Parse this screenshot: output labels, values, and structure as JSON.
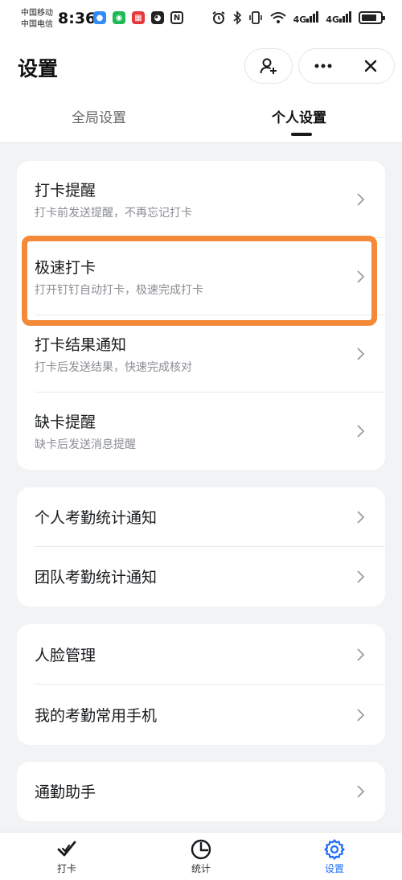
{
  "status_bar": {
    "carrier_1": "中国移动",
    "carrier_2": "中国电信",
    "time": "8:36",
    "signal_1": "4G",
    "signal_2": "4G"
  },
  "header": {
    "title": "设置",
    "add_contact_icon": "person-add-icon",
    "more_icon": "more-icon",
    "close_icon": "close-icon"
  },
  "tabs": [
    {
      "label": "全局设置",
      "active": false
    },
    {
      "label": "个人设置",
      "active": true
    }
  ],
  "cards": [
    {
      "items": [
        {
          "title": "打卡提醒",
          "subtitle": "打卡前发送提醒，不再忘记打卡"
        },
        {
          "title": "极速打卡",
          "subtitle": "打开钉钉自动打卡，极速完成打卡"
        },
        {
          "title": "打卡结果通知",
          "subtitle": "打卡后发送结果，快速完成核对"
        },
        {
          "title": "缺卡提醒",
          "subtitle": "缺卡后发送消息提醒"
        }
      ]
    },
    {
      "items": [
        {
          "title": "个人考勤统计通知"
        },
        {
          "title": "团队考勤统计通知"
        }
      ]
    },
    {
      "items": [
        {
          "title": "人脸管理"
        },
        {
          "title": "我的考勤常用手机"
        }
      ]
    },
    {
      "items": [
        {
          "title": "通勤助手"
        }
      ]
    }
  ],
  "bottom_nav": [
    {
      "label": "打卡",
      "icon": "check-icon",
      "active": false
    },
    {
      "label": "统计",
      "icon": "pie-chart-icon",
      "active": false
    },
    {
      "label": "设置",
      "icon": "gear-icon",
      "active": true
    }
  ],
  "colors": {
    "accent": "#1a6dfa",
    "highlight": "#f5893a",
    "background": "#f2f3f5"
  }
}
